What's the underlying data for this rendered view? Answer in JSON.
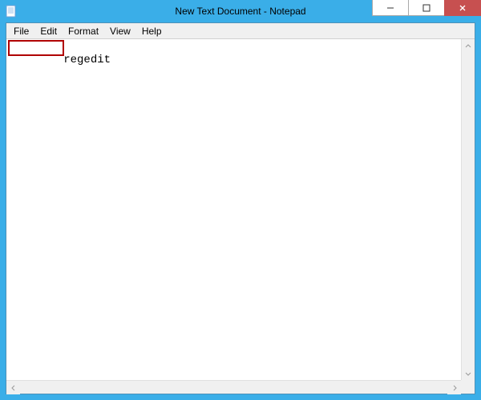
{
  "window": {
    "title": "New Text Document - Notepad",
    "controls": {
      "minimize": "–",
      "maximize": "▢",
      "close": "✕"
    }
  },
  "menu": {
    "file": "File",
    "edit": "Edit",
    "format": "Format",
    "view": "View",
    "help": "Help"
  },
  "editor": {
    "content": "regedit"
  },
  "scroll": {
    "up": "⌃",
    "down": "⌄",
    "left": "‹",
    "right": "›"
  }
}
